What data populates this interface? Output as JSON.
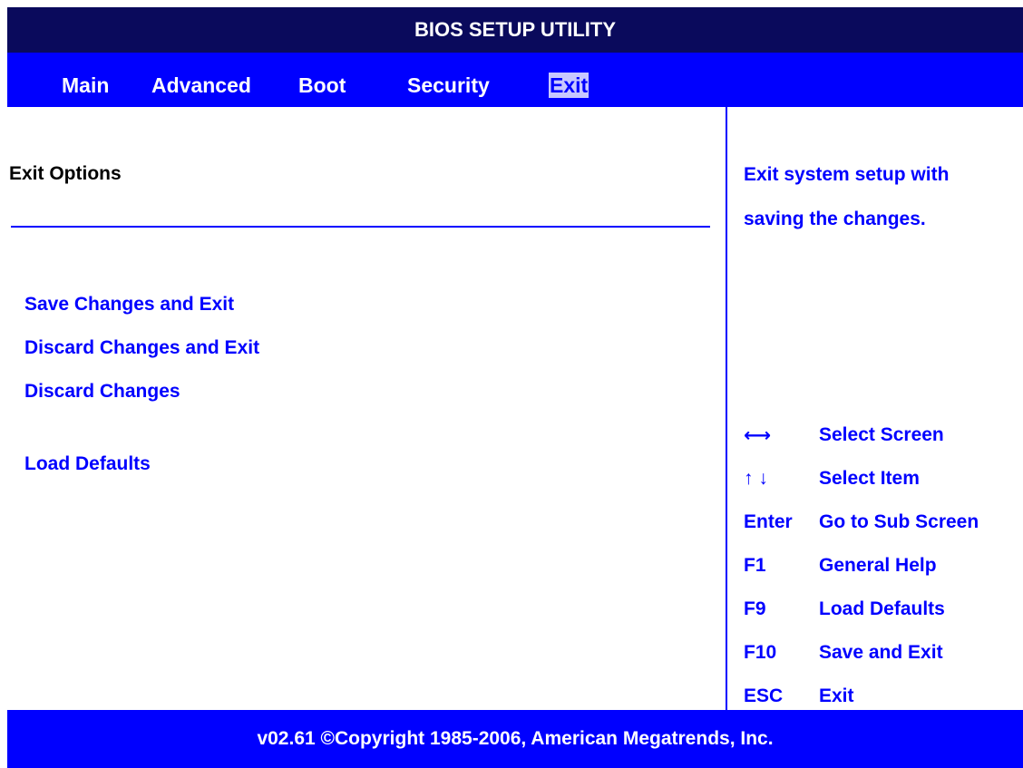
{
  "title": "BIOS SETUP UTILITY",
  "tabs": [
    {
      "label": "Main"
    },
    {
      "label": "Advanced"
    },
    {
      "label": "Boot"
    },
    {
      "label": "Security"
    },
    {
      "label": "Exit",
      "active": true
    }
  ],
  "section": {
    "title": "Exit Options"
  },
  "menu": [
    {
      "label": "Save Changes and Exit"
    },
    {
      "label": "Discard Changes and Exit"
    },
    {
      "label": "Discard Changes"
    },
    {
      "label": "Load Defaults"
    }
  ],
  "help": {
    "line1": "Exit system setup with",
    "line2": "saving the changes."
  },
  "keys": [
    {
      "key": "⟷",
      "desc": "Select Screen"
    },
    {
      "key": "↑ ↓",
      "desc": "Select Item"
    },
    {
      "key": "Enter",
      "desc": "Go to Sub Screen"
    },
    {
      "key": "F1",
      "desc": "General Help"
    },
    {
      "key": "F9",
      "desc": "Load Defaults"
    },
    {
      "key": "F10",
      "desc": "Save and Exit"
    },
    {
      "key": "ESC",
      "desc": "Exit"
    }
  ],
  "footer": "v02.61 ©Copyright 1985-2006, American Megatrends, Inc.",
  "colors": {
    "title_bar": "#0a0a5c",
    "accent_blue": "#0000ff",
    "active_tab_bg": "#c8c8ff"
  }
}
